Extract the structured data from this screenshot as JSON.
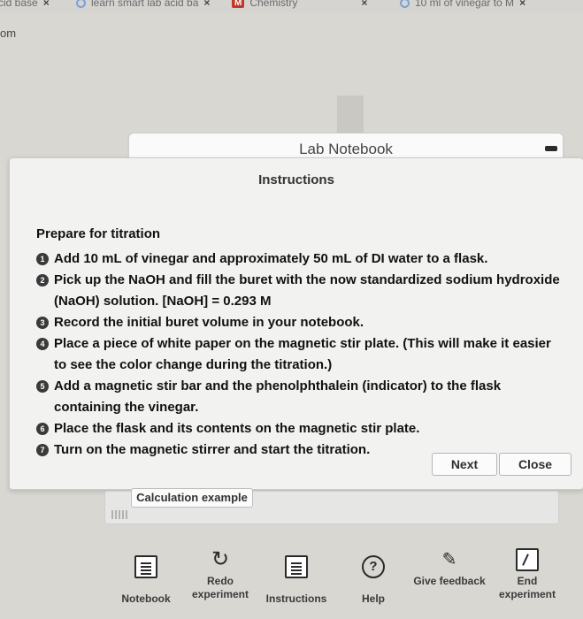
{
  "browser": {
    "tabs": [
      {
        "label": "cid base",
        "close": "×"
      },
      {
        "label": "learn smart lab acid ba",
        "close": "×"
      },
      {
        "label": "Chemistry",
        "close": "×"
      },
      {
        "label": "10 ml of vinegar to M",
        "close": "×"
      }
    ],
    "url_fragment": "om"
  },
  "notebook": {
    "title": "Lab Notebook"
  },
  "dialog": {
    "title": "Instructions",
    "section_heading": "Prepare for titration",
    "steps": [
      {
        "num": "1",
        "text": "Add 10 mL of vinegar and approximately 50 mL of DI water to a flask."
      },
      {
        "num": "2",
        "text": "Pick up the NaOH and fill the buret with the now standardized sodium hydroxide (NaOH) solution. [NaOH] = 0.293 M"
      },
      {
        "num": "3",
        "text": "Record the initial buret volume in your notebook."
      },
      {
        "num": "4",
        "text": "Place a piece of white paper on the magnetic stir plate. (This will make it easier to see the color change during the titration.)"
      },
      {
        "num": "5",
        "text": "Add a magnetic stir bar and the phenolphthalein (indicator) to the flask containing the vinegar."
      },
      {
        "num": "6",
        "text": "Place the flask and its contents on the magnetic stir plate."
      },
      {
        "num": "7",
        "text": "Turn on the magnetic stirrer and start the titration."
      }
    ],
    "next_label": "Next",
    "close_label": "Close"
  },
  "calc": {
    "tab_label": "Calculation example"
  },
  "toolbar": {
    "items": [
      {
        "label": "Notebook",
        "icon": "notebook-icon"
      },
      {
        "label": "Redo experiment",
        "icon": "redo-icon"
      },
      {
        "label": "Instructions",
        "icon": "instructions-icon"
      },
      {
        "label": "Help",
        "icon": "help-icon"
      },
      {
        "label": "Give feedback",
        "icon": "feedback-icon"
      },
      {
        "label": "End experiment",
        "icon": "end-experiment-icon"
      }
    ]
  }
}
